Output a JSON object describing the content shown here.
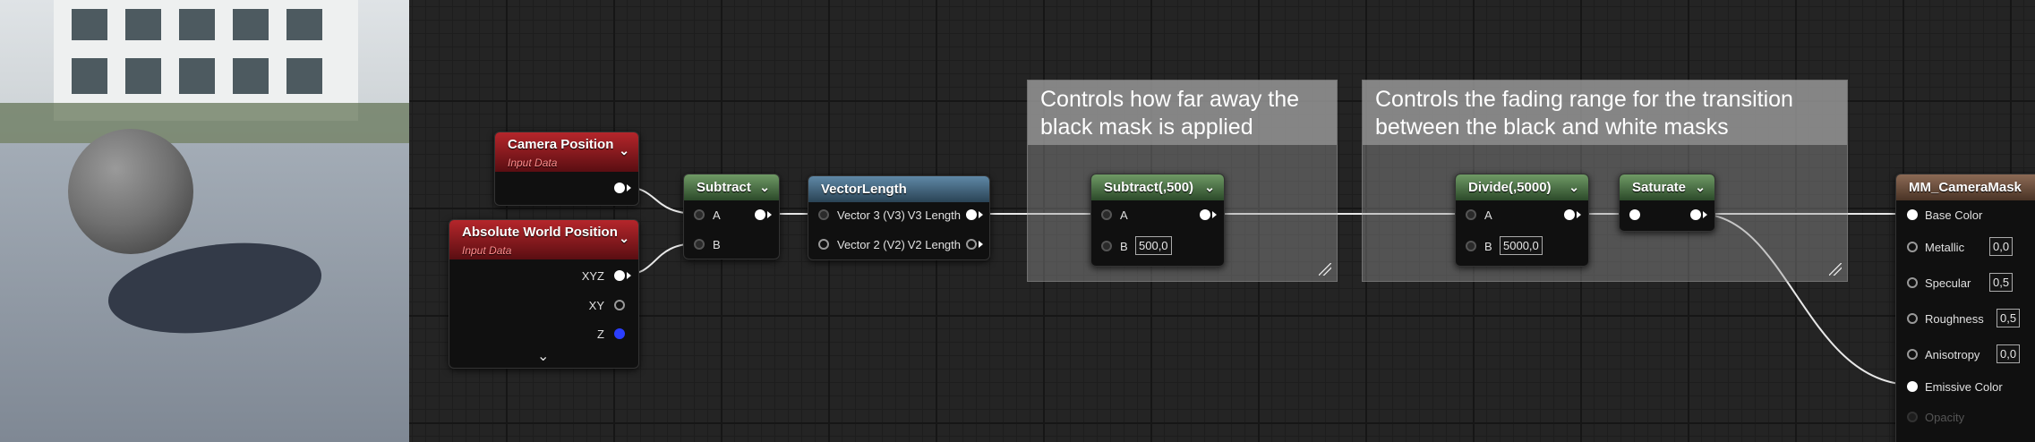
{
  "nodes": {
    "camera_position": {
      "title": "Camera Position",
      "subtitle": "Input Data"
    },
    "absolute_world_position": {
      "title": "Absolute World Position",
      "subtitle": "Input Data",
      "outputs": [
        "XYZ",
        "XY",
        "Z"
      ]
    },
    "subtract": {
      "title": "Subtract",
      "inputs": [
        "A",
        "B"
      ]
    },
    "vector_length": {
      "title": "VectorLength",
      "inputs": [
        "Vector 3 (V3)",
        "Vector 2 (V2)"
      ],
      "outputs": [
        "V3 Length",
        "V2 Length"
      ]
    },
    "subtract_500": {
      "title": "Subtract(,500)",
      "input_a": "A",
      "input_b": "B",
      "b_value": "500,0"
    },
    "divide_5000": {
      "title": "Divide(,5000)",
      "input_a": "A",
      "input_b": "B",
      "b_value": "5000,0"
    },
    "saturate": {
      "title": "Saturate"
    },
    "material": {
      "title": "MM_CameraMask",
      "inputs": [
        {
          "label": "Base Color",
          "value": ""
        },
        {
          "label": "Metallic",
          "value": "0,0"
        },
        {
          "label": "Specular",
          "value": "0,5"
        },
        {
          "label": "Roughness",
          "value": "0,5"
        },
        {
          "label": "Anisotropy",
          "value": "0,0"
        },
        {
          "label": "Emissive Color",
          "value": ""
        },
        {
          "label": "Opacity",
          "value": ""
        }
      ]
    }
  },
  "comments": {
    "distance": "Controls how far away the black mask is applied",
    "fade": "Controls the fading range for the transition between the black and white masks"
  },
  "colors": {
    "graph_bg": "#242424",
    "function_header": "#4f7a47",
    "vector_header": "#456c87",
    "input_data_header": "#a0232a",
    "result_header": "#7a5a46",
    "wire": "#ffffff",
    "comment": "#9a9a9a"
  },
  "icons": [
    "chevron-down-icon",
    "resize-grip-icon",
    "expand-chevron-icon"
  ]
}
